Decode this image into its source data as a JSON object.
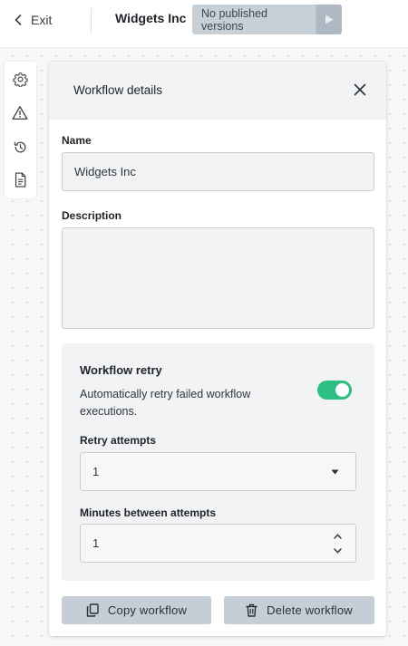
{
  "topbar": {
    "exit_label": "Exit",
    "company_name": "Widgets Inc",
    "publish_status": "No published versions"
  },
  "rail": {
    "icons": [
      "gear-icon",
      "warning-icon",
      "history-icon",
      "document-icon"
    ]
  },
  "panel": {
    "title": "Workflow details",
    "name_label": "Name",
    "name_value": "Widgets Inc",
    "description_label": "Description",
    "description_value": "",
    "retry": {
      "title": "Workflow retry",
      "description": "Automatically retry failed workflow executions.",
      "enabled": true,
      "attempts_label": "Retry attempts",
      "attempts_value": "1",
      "minutes_label": "Minutes between attempts",
      "minutes_value": "1"
    },
    "copy_button": "Copy workflow",
    "delete_button": "Delete workflow"
  },
  "colors": {
    "accent_toggle": "#2dbf82",
    "button_bg": "#c5ced7",
    "publish_bg": "#c7cfd7"
  }
}
